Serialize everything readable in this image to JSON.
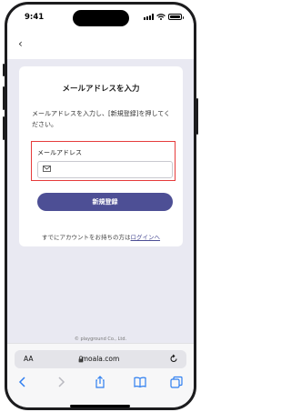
{
  "status_bar": {
    "time": "9:41"
  },
  "header": {
    "back_glyph": "‹"
  },
  "card": {
    "title": "メールアドレスを入力",
    "description": "メールアドレスを入力し、[新規登録]を押してください。",
    "email_label": "メールアドレス",
    "email_value": "",
    "email_placeholder": "",
    "submit_label": "新規登録",
    "login_prefix": "すでにアカウントをお持ちの方は",
    "login_link": "ログインへ"
  },
  "footer": {
    "copyright": "© playground Co., Ltd."
  },
  "browser": {
    "text_size_label": "AA",
    "url": "moala.com",
    "toolbar_icons": [
      "back-icon",
      "forward-icon",
      "share-icon",
      "bookmarks-icon",
      "tabs-icon"
    ]
  },
  "colors": {
    "accent": "#4d4f95",
    "highlight": "#e63b3b",
    "background": "#e9e9f2"
  }
}
